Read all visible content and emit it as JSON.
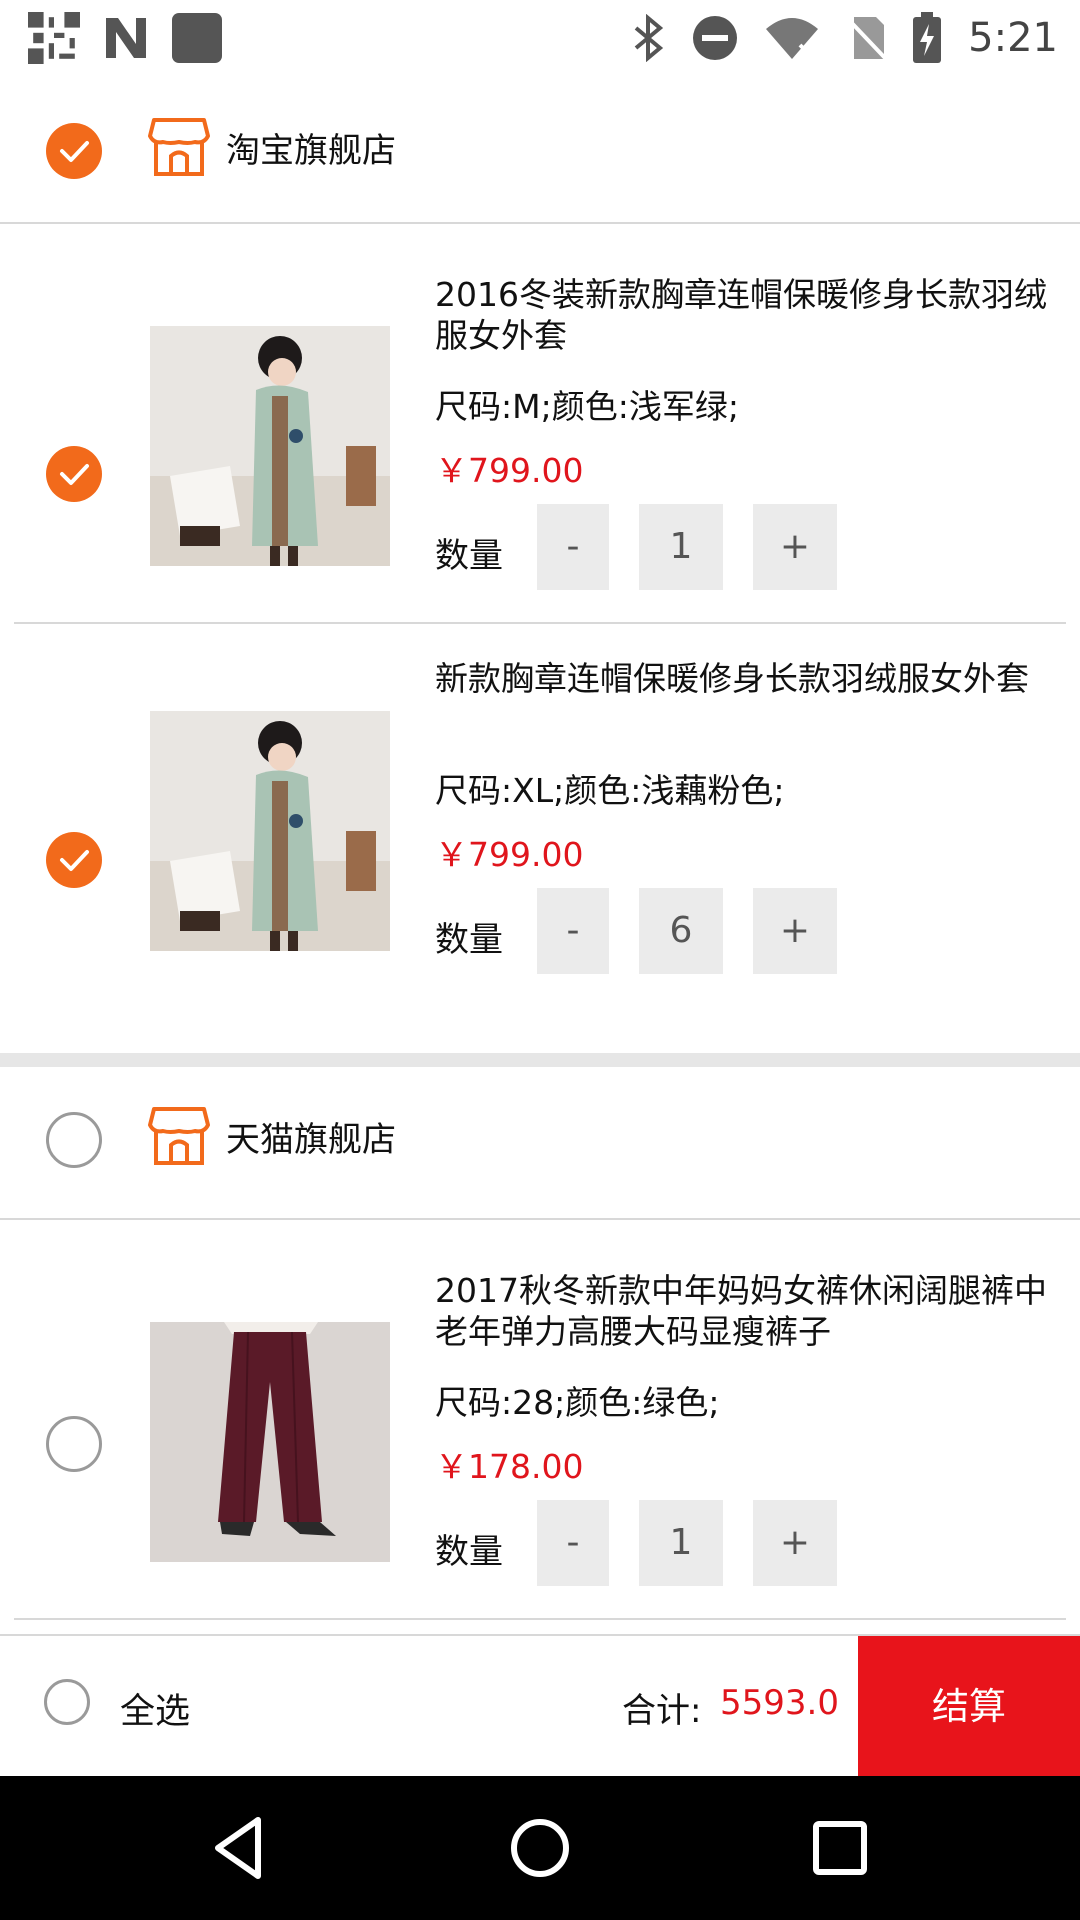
{
  "status_bar": {
    "time": "5:21"
  },
  "stores": [
    {
      "name": "淘宝旗舰店",
      "checked": true,
      "items": [
        {
          "title": "2016冬装新款胸章连帽保暖修身长款羽绒服女外套",
          "spec": "尺码:M;颜色:浅军绿;",
          "price": "￥799.00",
          "qty_label": "数量",
          "minus": "-",
          "qty": "1",
          "plus": "+",
          "checked": true,
          "image": "woman-green-coat-photo"
        },
        {
          "title": "新款胸章连帽保暖修身长款羽绒服女外套",
          "spec": "尺码:XL;颜色:浅藕粉色;",
          "price": "￥799.00",
          "qty_label": "数量",
          "minus": "-",
          "qty": "6",
          "plus": "+",
          "checked": true,
          "image": "woman-green-coat-photo"
        }
      ]
    },
    {
      "name": "天猫旗舰店",
      "checked": false,
      "items": [
        {
          "title": "2017秋冬新款中年妈妈女裤休闲阔腿裤中老年弹力高腰大码显瘦裤子",
          "spec": "尺码:28;颜色:绿色;",
          "price": "￥178.00",
          "qty_label": "数量",
          "minus": "-",
          "qty": "1",
          "plus": "+",
          "checked": false,
          "image": "burgundy-trousers-photo"
        }
      ]
    }
  ],
  "footer": {
    "select_all": "全选",
    "total_label": "合计:",
    "total_value": "5593.0",
    "checkout": "结算"
  },
  "colors": {
    "accent": "#F26A1B",
    "price_red": "#E0151C",
    "checkout_red": "#E8141B"
  }
}
